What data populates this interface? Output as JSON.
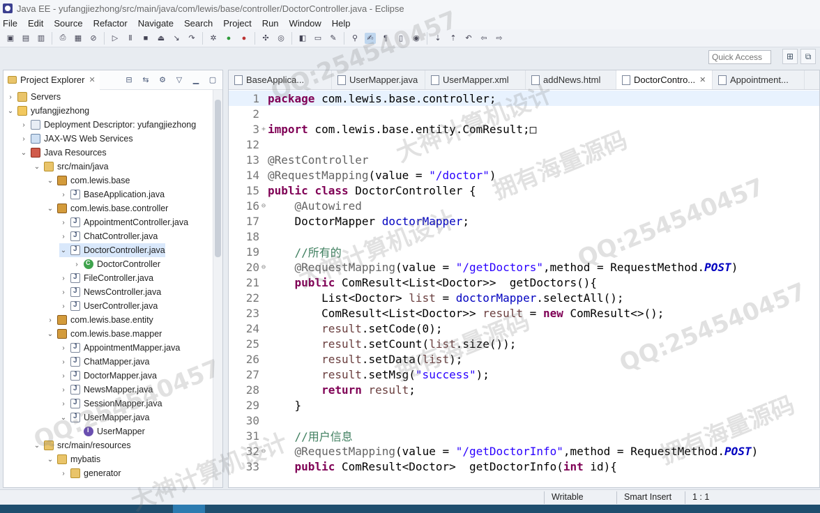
{
  "window": {
    "title": "Java EE - yufangjiezhong/src/main/java/com/lewis/base/controller/DoctorController.java - Eclipse"
  },
  "menu": [
    "File",
    "Edit",
    "Source",
    "Refactor",
    "Navigate",
    "Search",
    "Project",
    "Run",
    "Window",
    "Help"
  ],
  "quick_access": {
    "placeholder": "Quick Access"
  },
  "explorer": {
    "title": "Project Explorer",
    "items": [
      {
        "label": "Servers",
        "depth": 0,
        "arrow": "›",
        "icon": "folder"
      },
      {
        "label": "yufangjiezhong",
        "depth": 0,
        "arrow": "⌄",
        "icon": "project"
      },
      {
        "label": "Deployment Descriptor: yufangjiezhong",
        "depth": 1,
        "arrow": "›",
        "icon": "desc"
      },
      {
        "label": "JAX-WS Web Services",
        "depth": 1,
        "arrow": "›",
        "icon": "ws"
      },
      {
        "label": "Java Resources",
        "depth": 1,
        "arrow": "⌄",
        "icon": "jres"
      },
      {
        "label": "src/main/java",
        "depth": 2,
        "arrow": "⌄",
        "icon": "srcfolder"
      },
      {
        "label": "com.lewis.base",
        "depth": 3,
        "arrow": "⌄",
        "icon": "package"
      },
      {
        "label": "BaseApplication.java",
        "depth": 4,
        "arrow": "›",
        "icon": "java"
      },
      {
        "label": "com.lewis.base.controller",
        "depth": 3,
        "arrow": "⌄",
        "icon": "package"
      },
      {
        "label": "AppointmentController.java",
        "depth": 4,
        "arrow": "›",
        "icon": "java"
      },
      {
        "label": "ChatController.java",
        "depth": 4,
        "arrow": "›",
        "icon": "java"
      },
      {
        "label": "DoctorController.java",
        "depth": 4,
        "arrow": "⌄",
        "icon": "java",
        "selected": true
      },
      {
        "label": "DoctorController",
        "depth": 5,
        "arrow": "›",
        "icon": "class"
      },
      {
        "label": "FileController.java",
        "depth": 4,
        "arrow": "›",
        "icon": "java"
      },
      {
        "label": "NewsController.java",
        "depth": 4,
        "arrow": "›",
        "icon": "java"
      },
      {
        "label": "UserController.java",
        "depth": 4,
        "arrow": "›",
        "icon": "java"
      },
      {
        "label": "com.lewis.base.entity",
        "depth": 3,
        "arrow": "›",
        "icon": "package"
      },
      {
        "label": "com.lewis.base.mapper",
        "depth": 3,
        "arrow": "⌄",
        "icon": "package"
      },
      {
        "label": "AppointmentMapper.java",
        "depth": 4,
        "arrow": "›",
        "icon": "java"
      },
      {
        "label": "ChatMapper.java",
        "depth": 4,
        "arrow": "›",
        "icon": "java"
      },
      {
        "label": "DoctorMapper.java",
        "depth": 4,
        "arrow": "›",
        "icon": "java"
      },
      {
        "label": "NewsMapper.java",
        "depth": 4,
        "arrow": "›",
        "icon": "java"
      },
      {
        "label": "SessionMapper.java",
        "depth": 4,
        "arrow": "›",
        "icon": "java"
      },
      {
        "label": "UserMapper.java",
        "depth": 4,
        "arrow": "⌄",
        "icon": "java"
      },
      {
        "label": "UserMapper",
        "depth": 5,
        "arrow": "",
        "icon": "iface"
      },
      {
        "label": "src/main/resources",
        "depth": 2,
        "arrow": "⌄",
        "icon": "srcfolder"
      },
      {
        "label": "mybatis",
        "depth": 3,
        "arrow": "⌄",
        "icon": "folder"
      },
      {
        "label": "generator",
        "depth": 4,
        "arrow": "›",
        "icon": "folder"
      }
    ]
  },
  "editor": {
    "tabs": [
      {
        "label": "BaseApplica...",
        "active": false
      },
      {
        "label": "UserMapper.java",
        "active": false
      },
      {
        "label": "UserMapper.xml",
        "active": false
      },
      {
        "label": "addNews.html",
        "active": false
      },
      {
        "label": "DoctorContro...",
        "active": true
      },
      {
        "label": "Appointment...",
        "active": false
      }
    ],
    "lines": [
      {
        "n": "1",
        "fold": "",
        "tokens": [
          [
            "kw",
            "package"
          ],
          [
            "txt",
            " com.lewis.base.controller;"
          ]
        ],
        "current": true
      },
      {
        "n": "2",
        "fold": "",
        "tokens": []
      },
      {
        "n": "3",
        "fold": "+",
        "tokens": [
          [
            "kw",
            "import"
          ],
          [
            "txt",
            " com.lewis.base.entity.ComResult;"
          ],
          [
            "txt",
            "□"
          ]
        ]
      },
      {
        "n": "12",
        "fold": "",
        "tokens": []
      },
      {
        "n": "13",
        "fold": "",
        "tokens": [
          [
            "ann",
            "@RestController"
          ]
        ]
      },
      {
        "n": "14",
        "fold": "",
        "tokens": [
          [
            "ann",
            "@RequestMapping"
          ],
          [
            "txt",
            "(value = "
          ],
          [
            "str",
            "\"/doctor\""
          ],
          [
            "txt",
            ")"
          ]
        ]
      },
      {
        "n": "15",
        "fold": "",
        "tokens": [
          [
            "kw",
            "public"
          ],
          [
            "txt",
            " "
          ],
          [
            "kw",
            "class"
          ],
          [
            "txt",
            " DoctorController {"
          ]
        ]
      },
      {
        "n": "16",
        "fold": "⊖",
        "tokens": [
          [
            "txt",
            "    "
          ],
          [
            "ann",
            "@Autowired"
          ]
        ]
      },
      {
        "n": "17",
        "fold": "",
        "tokens": [
          [
            "txt",
            "    DoctorMapper "
          ],
          [
            "fld",
            "doctorMapper"
          ],
          [
            "txt",
            ";"
          ]
        ]
      },
      {
        "n": "18",
        "fold": "",
        "tokens": []
      },
      {
        "n": "19",
        "fold": "",
        "tokens": [
          [
            "txt",
            "    "
          ],
          [
            "cmt",
            "//所有的"
          ]
        ]
      },
      {
        "n": "20",
        "fold": "⊖",
        "tokens": [
          [
            "txt",
            "    "
          ],
          [
            "ann",
            "@RequestMapping"
          ],
          [
            "txt",
            "(value = "
          ],
          [
            "str",
            "\"/getDoctors\""
          ],
          [
            "txt",
            ",method = RequestMethod."
          ],
          [
            "sta",
            "POST"
          ],
          [
            "txt",
            ")"
          ]
        ]
      },
      {
        "n": "21",
        "fold": "",
        "tokens": [
          [
            "txt",
            "    "
          ],
          [
            "kw",
            "public"
          ],
          [
            "txt",
            " ComResult<List<Doctor>>  getDoctors(){"
          ]
        ]
      },
      {
        "n": "22",
        "fold": "",
        "tokens": [
          [
            "txt",
            "        List<Doctor> "
          ],
          [
            "loc",
            "list"
          ],
          [
            "txt",
            " = "
          ],
          [
            "fld",
            "doctorMapper"
          ],
          [
            "txt",
            ".selectAll();"
          ]
        ]
      },
      {
        "n": "23",
        "fold": "",
        "tokens": [
          [
            "txt",
            "        ComResult<List<Doctor>> "
          ],
          [
            "loc",
            "result"
          ],
          [
            "txt",
            " = "
          ],
          [
            "kw",
            "new"
          ],
          [
            "txt",
            " ComResult<>();"
          ]
        ]
      },
      {
        "n": "24",
        "fold": "",
        "tokens": [
          [
            "txt",
            "        "
          ],
          [
            "loc",
            "result"
          ],
          [
            "txt",
            ".setCode(0);"
          ]
        ]
      },
      {
        "n": "25",
        "fold": "",
        "tokens": [
          [
            "txt",
            "        "
          ],
          [
            "loc",
            "result"
          ],
          [
            "txt",
            ".setCount("
          ],
          [
            "loc",
            "list"
          ],
          [
            "txt",
            ".size());"
          ]
        ]
      },
      {
        "n": "26",
        "fold": "",
        "tokens": [
          [
            "txt",
            "        "
          ],
          [
            "loc",
            "result"
          ],
          [
            "txt",
            ".setData("
          ],
          [
            "loc",
            "list"
          ],
          [
            "txt",
            ");"
          ]
        ]
      },
      {
        "n": "27",
        "fold": "",
        "tokens": [
          [
            "txt",
            "        "
          ],
          [
            "loc",
            "result"
          ],
          [
            "txt",
            ".setMsg("
          ],
          [
            "str",
            "\"success\""
          ],
          [
            "txt",
            ");"
          ]
        ]
      },
      {
        "n": "28",
        "fold": "",
        "tokens": [
          [
            "txt",
            "        "
          ],
          [
            "kw",
            "return"
          ],
          [
            "txt",
            " "
          ],
          [
            "loc",
            "result"
          ],
          [
            "txt",
            ";"
          ]
        ]
      },
      {
        "n": "29",
        "fold": "",
        "tokens": [
          [
            "txt",
            "    }"
          ]
        ]
      },
      {
        "n": "30",
        "fold": "",
        "tokens": []
      },
      {
        "n": "31",
        "fold": "",
        "tokens": [
          [
            "txt",
            "    "
          ],
          [
            "cmt",
            "//用户信息"
          ]
        ]
      },
      {
        "n": "32",
        "fold": "⊖",
        "tokens": [
          [
            "txt",
            "    "
          ],
          [
            "ann",
            "@RequestMapping"
          ],
          [
            "txt",
            "(value = "
          ],
          [
            "str",
            "\"/getDoctorInfo\""
          ],
          [
            "txt",
            ",method = RequestMethod."
          ],
          [
            "sta",
            "POST"
          ],
          [
            "txt",
            ")"
          ]
        ]
      },
      {
        "n": "33",
        "fold": "",
        "tokens": [
          [
            "txt",
            "    "
          ],
          [
            "kw",
            "public"
          ],
          [
            "txt",
            " ComResult<Doctor>  getDoctorInfo("
          ],
          [
            "kw",
            "int"
          ],
          [
            "txt",
            " id){"
          ]
        ]
      }
    ]
  },
  "status": {
    "writable": "Writable",
    "insert_mode": "Smart Insert",
    "position": "1 : 1"
  },
  "watermarks": [
    "QQ:254540457",
    "大神计算机设计",
    "拥有海量源码",
    "QQ:254540457",
    "大神计算机设计",
    "拥有海量源码",
    "QQ:254540457",
    "QQ:254540457",
    "拥有海量源码",
    "大神计算机设计"
  ]
}
